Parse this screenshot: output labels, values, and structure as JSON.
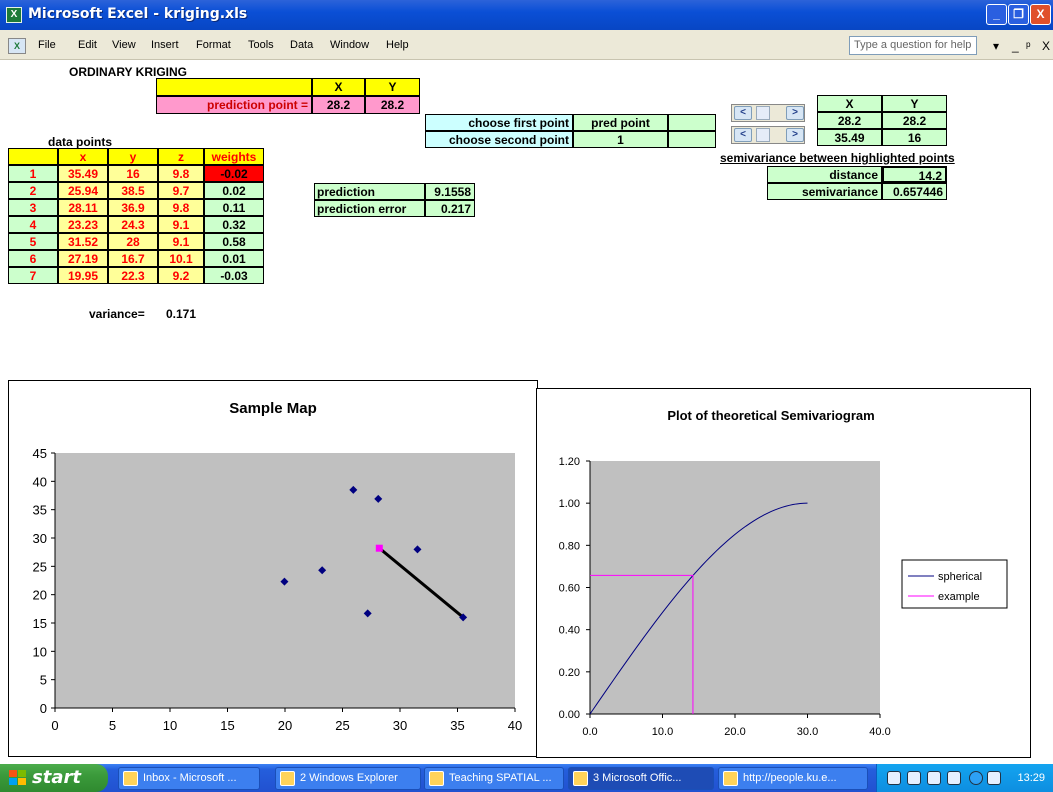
{
  "window": {
    "title": "Microsoft Excel - kriging.xls",
    "buttons": [
      "_",
      "❐",
      "X"
    ]
  },
  "menu": {
    "items": [
      "File",
      "Edit",
      "View",
      "Insert",
      "Format",
      "Tools",
      "Data",
      "Window",
      "Help"
    ],
    "help_placeholder": "Type a question for help",
    "controls": [
      "▾",
      "_",
      "ᵖ",
      "X"
    ]
  },
  "sheet": {
    "heading": "ORDINARY KRIGING",
    "pred_header_x": "X",
    "pred_header_y": "Y",
    "pred_label": "prediction point =",
    "pred_x": "28.2",
    "pred_y": "28.2",
    "data_points_label": "data points",
    "table_headers": [
      "",
      "x",
      "y",
      "z",
      "weights"
    ],
    "rows": [
      {
        "id": "1",
        "x": "35.49",
        "y": "16",
        "z": "9.8",
        "w": "-0.02"
      },
      {
        "id": "2",
        "x": "25.94",
        "y": "38.5",
        "z": "9.7",
        "w": "0.02"
      },
      {
        "id": "3",
        "x": "28.11",
        "y": "36.9",
        "z": "9.8",
        "w": "0.11"
      },
      {
        "id": "4",
        "x": "23.23",
        "y": "24.3",
        "z": "9.1",
        "w": "0.32"
      },
      {
        "id": "5",
        "x": "31.52",
        "y": "28",
        "z": "9.1",
        "w": "0.58"
      },
      {
        "id": "6",
        "x": "27.19",
        "y": "16.7",
        "z": "10.1",
        "w": "0.01"
      },
      {
        "id": "7",
        "x": "19.95",
        "y": "22.3",
        "z": "9.2",
        "w": "-0.03"
      }
    ],
    "variance_label": "variance=",
    "variance_value": "0.171",
    "prediction_label": "prediction",
    "prediction_value": "9.1558",
    "pred_error_label": "prediction error",
    "pred_error_value": "0.217",
    "choose_first_label": "choose first point",
    "choose_first_value": "pred point",
    "choose_second_label": "choose second point",
    "choose_second_value": "1",
    "sel_header_x": "X",
    "sel_header_y": "Y",
    "sel_r1_x": "28.2",
    "sel_r1_y": "28.2",
    "sel_r2_x": "35.49",
    "sel_r2_y": "16",
    "semivar_heading": "semivariance between highlighted points",
    "distance_label": "distance",
    "distance_value": "14.2",
    "semivariance_label": "semivariance",
    "semivariance_value": "0.657446",
    "spin_left": "<",
    "spin_right": ">"
  },
  "chart_data": [
    {
      "type": "scatter",
      "title": "Sample Map",
      "xlim": [
        0,
        40
      ],
      "ylim": [
        0,
        45
      ],
      "xticks": [
        "0",
        "5",
        "10",
        "15",
        "20",
        "25",
        "30",
        "35",
        "40"
      ],
      "yticks": [
        "0",
        "5",
        "10",
        "15",
        "20",
        "25",
        "30",
        "35",
        "40",
        "45"
      ],
      "grid": false,
      "series": [
        {
          "kind": "points",
          "color": "#000080",
          "points": [
            [
              35.49,
              16
            ],
            [
              25.94,
              38.5
            ],
            [
              28.11,
              36.9
            ],
            [
              23.23,
              24.3
            ],
            [
              31.52,
              28
            ],
            [
              27.19,
              16.7
            ],
            [
              19.95,
              22.3
            ]
          ]
        },
        {
          "kind": "prediction",
          "color": "#ff00ff",
          "points": [
            [
              28.2,
              28.2
            ]
          ]
        },
        {
          "kind": "link",
          "color": "#000000",
          "points": [
            [
              28.2,
              28.2
            ],
            [
              35.49,
              16
            ]
          ]
        }
      ]
    },
    {
      "type": "line",
      "title": "Plot of theoretical Semivariogram",
      "xlim": [
        0,
        40
      ],
      "ylim": [
        0,
        1.2
      ],
      "xticks": [
        "0.0",
        "10.0",
        "20.0",
        "30.0",
        "40.0"
      ],
      "yticks": [
        "0.00",
        "0.20",
        "0.40",
        "0.60",
        "0.80",
        "1.00",
        "1.20"
      ],
      "grid": false,
      "legend_position": "right",
      "series": [
        {
          "name": "spherical",
          "color": "#000080",
          "range": 30,
          "sill": 1.0
        },
        {
          "name": "example",
          "color": "#ff00ff",
          "x": 14.2,
          "y": 0.657446
        }
      ]
    }
  ],
  "taskbar": {
    "start": "start",
    "tasks": [
      {
        "label": "Inbox - Microsoft ...",
        "active": false
      },
      {
        "label": "2 Windows Explorer",
        "active": false
      },
      {
        "label": "Teaching SPATIAL ...",
        "active": false
      },
      {
        "label": "3 Microsoft Offic...",
        "active": true
      },
      {
        "label": "http://people.ku.e...",
        "active": false
      }
    ],
    "clock": "13:29"
  }
}
